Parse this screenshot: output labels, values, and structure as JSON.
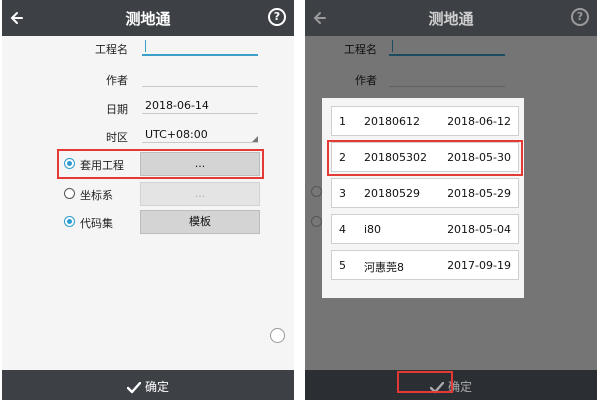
{
  "header": {
    "title": "测地通",
    "help": "?"
  },
  "form": {
    "project_name_label": "工程名",
    "project_name_value": "",
    "author_label": "作者",
    "author_value": "",
    "date_label": "日期",
    "date_value": "2018-06-14",
    "timezone_label": "时区",
    "timezone_value": "UTC+08:00",
    "apply_project_label": "套用工程",
    "apply_project_button": "...",
    "coord_label": "坐标系",
    "coord_button": "...",
    "codeset_label": "代码集",
    "codeset_button": "模板"
  },
  "footer": {
    "ok_label": "确定"
  },
  "project_list": [
    {
      "num": "1",
      "code": "20180612",
      "date": "2018-06-12"
    },
    {
      "num": "2",
      "code": "201805302",
      "date": "2018-05-30"
    },
    {
      "num": "3",
      "code": "20180529",
      "date": "2018-05-29"
    },
    {
      "num": "4",
      "code": "i80",
      "date": "2018-05-04"
    },
    {
      "num": "5",
      "code": "河惠莞8",
      "date": "2017-09-19"
    }
  ],
  "colors": {
    "header": "#3d4146",
    "accent": "#2b9bd1",
    "highlight": "#e53935"
  }
}
